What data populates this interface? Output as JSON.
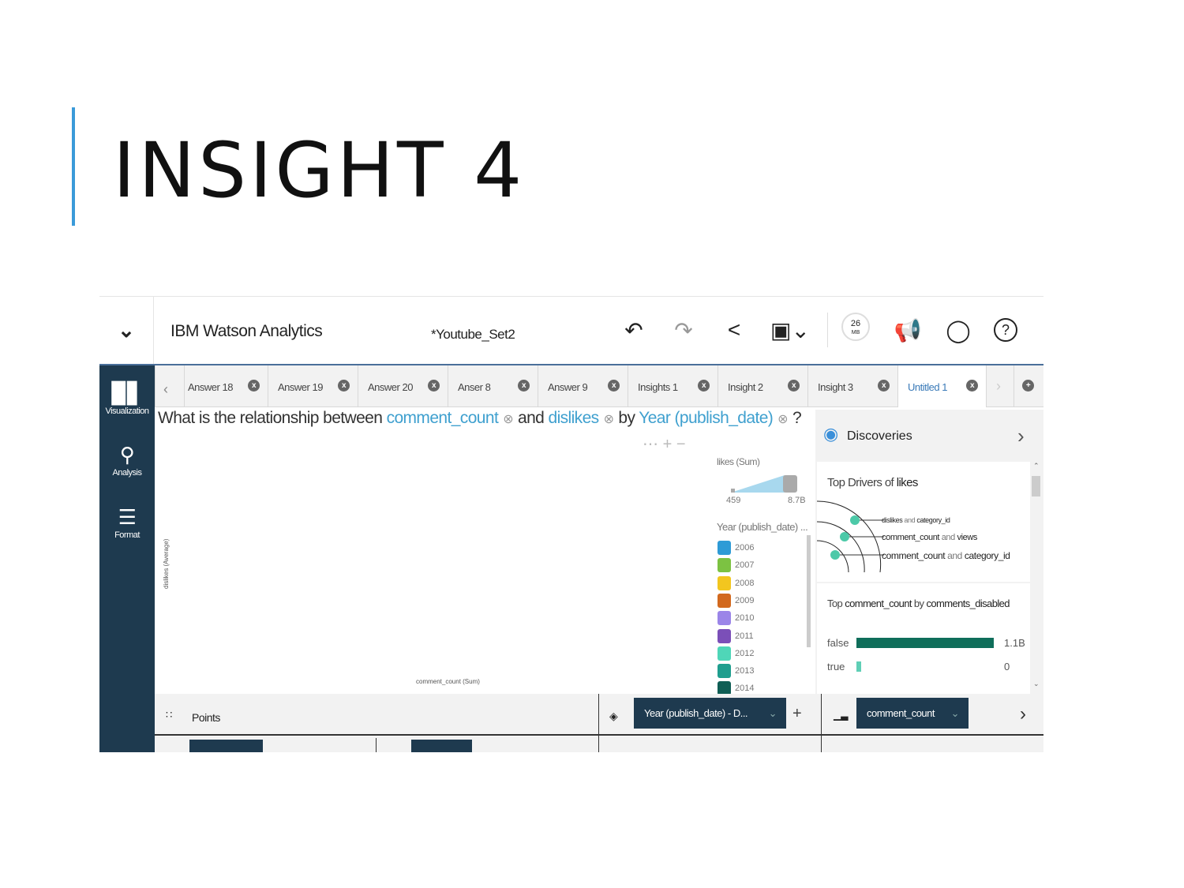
{
  "slide": {
    "title": "INSIGHT 4"
  },
  "app": {
    "brand": "IBM Watson Analytics",
    "document": "*Youtube_Set2",
    "memory": {
      "value": "26",
      "unit": "MB"
    }
  },
  "sidebar": [
    {
      "label": "Visualization",
      "icon": "bar-chart-icon"
    },
    {
      "label": "Analysis",
      "icon": "magnify-chart-icon"
    },
    {
      "label": "Format",
      "icon": "sliders-icon"
    }
  ],
  "tabs": [
    {
      "label": "Answer 18"
    },
    {
      "label": "Answer 19"
    },
    {
      "label": "Answer 20"
    },
    {
      "label": "Anser 8"
    },
    {
      "label": "Answer 9"
    },
    {
      "label": "Insights 1"
    },
    {
      "label": "Insight 2"
    },
    {
      "label": "Insight 3"
    },
    {
      "label": "Untitled 1",
      "active": true
    }
  ],
  "question": {
    "prefix": "What is the relationship between",
    "field1": "comment_count",
    "and": "and",
    "field2": "dislikes",
    "by": "by",
    "field3": "Year (publish_date)",
    "suffix": "?"
  },
  "chart": {
    "ylabel": "dislikes (Average)",
    "xlabel": "comment_count (Sum)"
  },
  "legend": {
    "size_title": "likes (Sum)",
    "size_min": "459",
    "size_max": "8.7B",
    "color_title": "Year (publish_date) ...",
    "items": [
      {
        "label": "2006",
        "color": "#2e9bd6"
      },
      {
        "label": "2007",
        "color": "#7cc242"
      },
      {
        "label": "2008",
        "color": "#f2c61f"
      },
      {
        "label": "2009",
        "color": "#d2691e"
      },
      {
        "label": "2010",
        "color": "#9b85e8"
      },
      {
        "label": "2011",
        "color": "#7b4fb8"
      },
      {
        "label": "2012",
        "color": "#4fd6b8"
      },
      {
        "label": "2013",
        "color": "#1f9e8e"
      },
      {
        "label": "2014",
        "color": "#0f5e55"
      }
    ]
  },
  "discoveries": {
    "title": "Discoveries",
    "drivers": {
      "prefix": "Top Drivers of",
      "target": "likes",
      "items": [
        {
          "a": "dislikes",
          "b": "category_id"
        },
        {
          "a": "comment_count",
          "b": "views"
        },
        {
          "a": "comment_count",
          "b": "category_id"
        }
      ],
      "and": "and"
    },
    "top": {
      "prefix": "Top",
      "measure": "comment_count",
      "by": "by",
      "dim": "comments_disabled",
      "rows": [
        {
          "label": "false",
          "value": "1.1B",
          "fraction": 1.0
        },
        {
          "label": "true",
          "value": "0",
          "fraction": 0.03
        }
      ]
    }
  },
  "bottom": {
    "chart_type": "Points",
    "color_field": "Year (publish_date) - D...",
    "size_field": "comment_count"
  },
  "colors": {
    "sidebar": "#1e3a4f",
    "accent": "#3fa0cf",
    "bar": "#0f6e5a"
  }
}
